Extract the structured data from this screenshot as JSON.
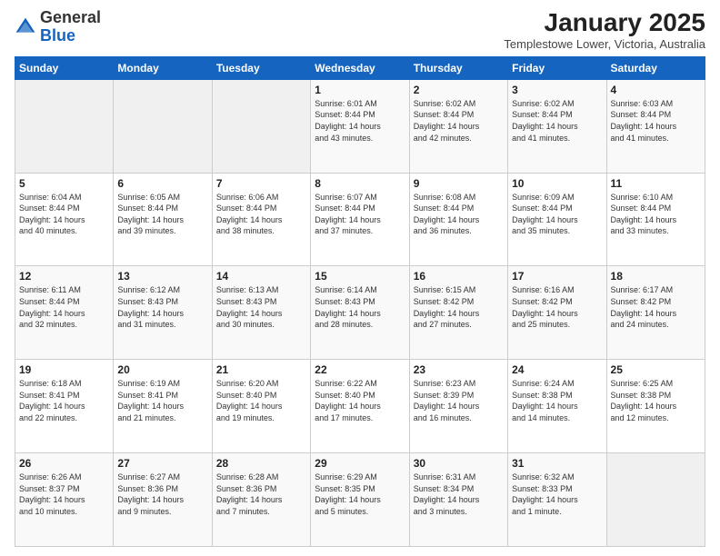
{
  "header": {
    "logo_general": "General",
    "logo_blue": "Blue",
    "month_title": "January 2025",
    "location": "Templestowe Lower, Victoria, Australia"
  },
  "days_of_week": [
    "Sunday",
    "Monday",
    "Tuesday",
    "Wednesday",
    "Thursday",
    "Friday",
    "Saturday"
  ],
  "weeks": [
    [
      {
        "day": "",
        "info": ""
      },
      {
        "day": "",
        "info": ""
      },
      {
        "day": "",
        "info": ""
      },
      {
        "day": "1",
        "info": "Sunrise: 6:01 AM\nSunset: 8:44 PM\nDaylight: 14 hours\nand 43 minutes."
      },
      {
        "day": "2",
        "info": "Sunrise: 6:02 AM\nSunset: 8:44 PM\nDaylight: 14 hours\nand 42 minutes."
      },
      {
        "day": "3",
        "info": "Sunrise: 6:02 AM\nSunset: 8:44 PM\nDaylight: 14 hours\nand 41 minutes."
      },
      {
        "day": "4",
        "info": "Sunrise: 6:03 AM\nSunset: 8:44 PM\nDaylight: 14 hours\nand 41 minutes."
      }
    ],
    [
      {
        "day": "5",
        "info": "Sunrise: 6:04 AM\nSunset: 8:44 PM\nDaylight: 14 hours\nand 40 minutes."
      },
      {
        "day": "6",
        "info": "Sunrise: 6:05 AM\nSunset: 8:44 PM\nDaylight: 14 hours\nand 39 minutes."
      },
      {
        "day": "7",
        "info": "Sunrise: 6:06 AM\nSunset: 8:44 PM\nDaylight: 14 hours\nand 38 minutes."
      },
      {
        "day": "8",
        "info": "Sunrise: 6:07 AM\nSunset: 8:44 PM\nDaylight: 14 hours\nand 37 minutes."
      },
      {
        "day": "9",
        "info": "Sunrise: 6:08 AM\nSunset: 8:44 PM\nDaylight: 14 hours\nand 36 minutes."
      },
      {
        "day": "10",
        "info": "Sunrise: 6:09 AM\nSunset: 8:44 PM\nDaylight: 14 hours\nand 35 minutes."
      },
      {
        "day": "11",
        "info": "Sunrise: 6:10 AM\nSunset: 8:44 PM\nDaylight: 14 hours\nand 33 minutes."
      }
    ],
    [
      {
        "day": "12",
        "info": "Sunrise: 6:11 AM\nSunset: 8:44 PM\nDaylight: 14 hours\nand 32 minutes."
      },
      {
        "day": "13",
        "info": "Sunrise: 6:12 AM\nSunset: 8:43 PM\nDaylight: 14 hours\nand 31 minutes."
      },
      {
        "day": "14",
        "info": "Sunrise: 6:13 AM\nSunset: 8:43 PM\nDaylight: 14 hours\nand 30 minutes."
      },
      {
        "day": "15",
        "info": "Sunrise: 6:14 AM\nSunset: 8:43 PM\nDaylight: 14 hours\nand 28 minutes."
      },
      {
        "day": "16",
        "info": "Sunrise: 6:15 AM\nSunset: 8:42 PM\nDaylight: 14 hours\nand 27 minutes."
      },
      {
        "day": "17",
        "info": "Sunrise: 6:16 AM\nSunset: 8:42 PM\nDaylight: 14 hours\nand 25 minutes."
      },
      {
        "day": "18",
        "info": "Sunrise: 6:17 AM\nSunset: 8:42 PM\nDaylight: 14 hours\nand 24 minutes."
      }
    ],
    [
      {
        "day": "19",
        "info": "Sunrise: 6:18 AM\nSunset: 8:41 PM\nDaylight: 14 hours\nand 22 minutes."
      },
      {
        "day": "20",
        "info": "Sunrise: 6:19 AM\nSunset: 8:41 PM\nDaylight: 14 hours\nand 21 minutes."
      },
      {
        "day": "21",
        "info": "Sunrise: 6:20 AM\nSunset: 8:40 PM\nDaylight: 14 hours\nand 19 minutes."
      },
      {
        "day": "22",
        "info": "Sunrise: 6:22 AM\nSunset: 8:40 PM\nDaylight: 14 hours\nand 17 minutes."
      },
      {
        "day": "23",
        "info": "Sunrise: 6:23 AM\nSunset: 8:39 PM\nDaylight: 14 hours\nand 16 minutes."
      },
      {
        "day": "24",
        "info": "Sunrise: 6:24 AM\nSunset: 8:38 PM\nDaylight: 14 hours\nand 14 minutes."
      },
      {
        "day": "25",
        "info": "Sunrise: 6:25 AM\nSunset: 8:38 PM\nDaylight: 14 hours\nand 12 minutes."
      }
    ],
    [
      {
        "day": "26",
        "info": "Sunrise: 6:26 AM\nSunset: 8:37 PM\nDaylight: 14 hours\nand 10 minutes."
      },
      {
        "day": "27",
        "info": "Sunrise: 6:27 AM\nSunset: 8:36 PM\nDaylight: 14 hours\nand 9 minutes."
      },
      {
        "day": "28",
        "info": "Sunrise: 6:28 AM\nSunset: 8:36 PM\nDaylight: 14 hours\nand 7 minutes."
      },
      {
        "day": "29",
        "info": "Sunrise: 6:29 AM\nSunset: 8:35 PM\nDaylight: 14 hours\nand 5 minutes."
      },
      {
        "day": "30",
        "info": "Sunrise: 6:31 AM\nSunset: 8:34 PM\nDaylight: 14 hours\nand 3 minutes."
      },
      {
        "day": "31",
        "info": "Sunrise: 6:32 AM\nSunset: 8:33 PM\nDaylight: 14 hours\nand 1 minute."
      },
      {
        "day": "",
        "info": ""
      }
    ]
  ]
}
